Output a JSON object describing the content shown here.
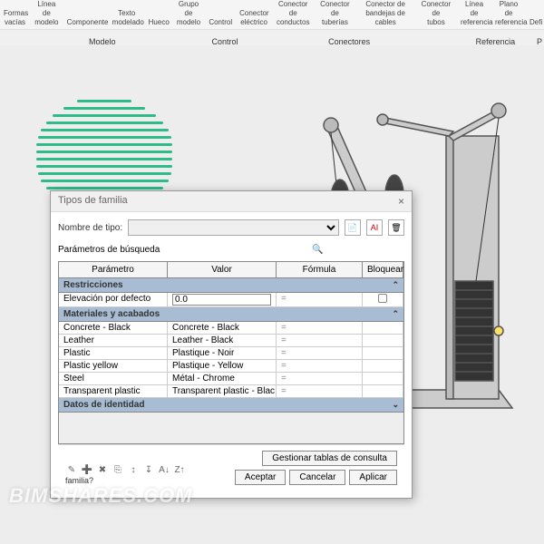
{
  "ribbon": {
    "items": [
      {
        "l1": "Formas",
        "l2": "vacías"
      },
      {
        "l1": "Línea de",
        "l2": "modelo"
      },
      {
        "l1": "Componente",
        "l2": ""
      },
      {
        "l1": "Texto",
        "l2": "modelado"
      },
      {
        "l1": "Hueco",
        "l2": ""
      },
      {
        "l1": "Grupo de",
        "l2": "modelo"
      },
      {
        "l1": "Control",
        "l2": ""
      },
      {
        "l1": "Conector",
        "l2": "eléctrico"
      },
      {
        "l1": "Conector de",
        "l2": "conductos"
      },
      {
        "l1": "Conector de",
        "l2": "tuberías"
      },
      {
        "l1": "Conector de",
        "l2": "bandejas de cables"
      },
      {
        "l1": "Conector de",
        "l2": "tubos"
      },
      {
        "l1": "Línea de",
        "l2": "referencia"
      },
      {
        "l1": "Plano de",
        "l2": "referencia"
      },
      {
        "l1": "Defi",
        "l2": ""
      }
    ],
    "groups": [
      "Modelo",
      "Control",
      "Conectores",
      "Referencia",
      "P"
    ]
  },
  "dialog": {
    "title": "Tipos de familia",
    "nombre_label": "Nombre de tipo:",
    "search_label": "Parámetros de búsqueda",
    "headers": {
      "param": "Parámetro",
      "valor": "Valor",
      "formula": "Fórmula",
      "lock": "Bloquear"
    },
    "groups": {
      "restricciones": "Restricciones",
      "materiales": "Materiales y acabados",
      "datos": "Datos de identidad"
    },
    "rows": {
      "elevacion": {
        "p": "Elevación por defecto",
        "v": "0.0",
        "f": "="
      },
      "concrete": {
        "p": "Concrete - Black",
        "v": "Concrete - Black",
        "f": "="
      },
      "leather": {
        "p": "Leather",
        "v": "Leather - Black",
        "f": "="
      },
      "plastic": {
        "p": "Plastic",
        "v": "Plastique - Noir",
        "f": "="
      },
      "plasticy": {
        "p": "Plastic yellow",
        "v": "Plastique - Yellow",
        "f": "="
      },
      "steel": {
        "p": "Steel",
        "v": "Métal - Chrome",
        "f": "="
      },
      "transparent": {
        "p": "Transparent plastic",
        "v": "Transparent plastic - Blac",
        "f": "="
      }
    },
    "footer": {
      "q": "familia?",
      "gestionar": "Gestionar tablas de consulta",
      "aceptar": "Aceptar",
      "cancelar": "Cancelar",
      "aplicar": "Aplicar"
    }
  },
  "watermark": "BIMSHARES.COM"
}
